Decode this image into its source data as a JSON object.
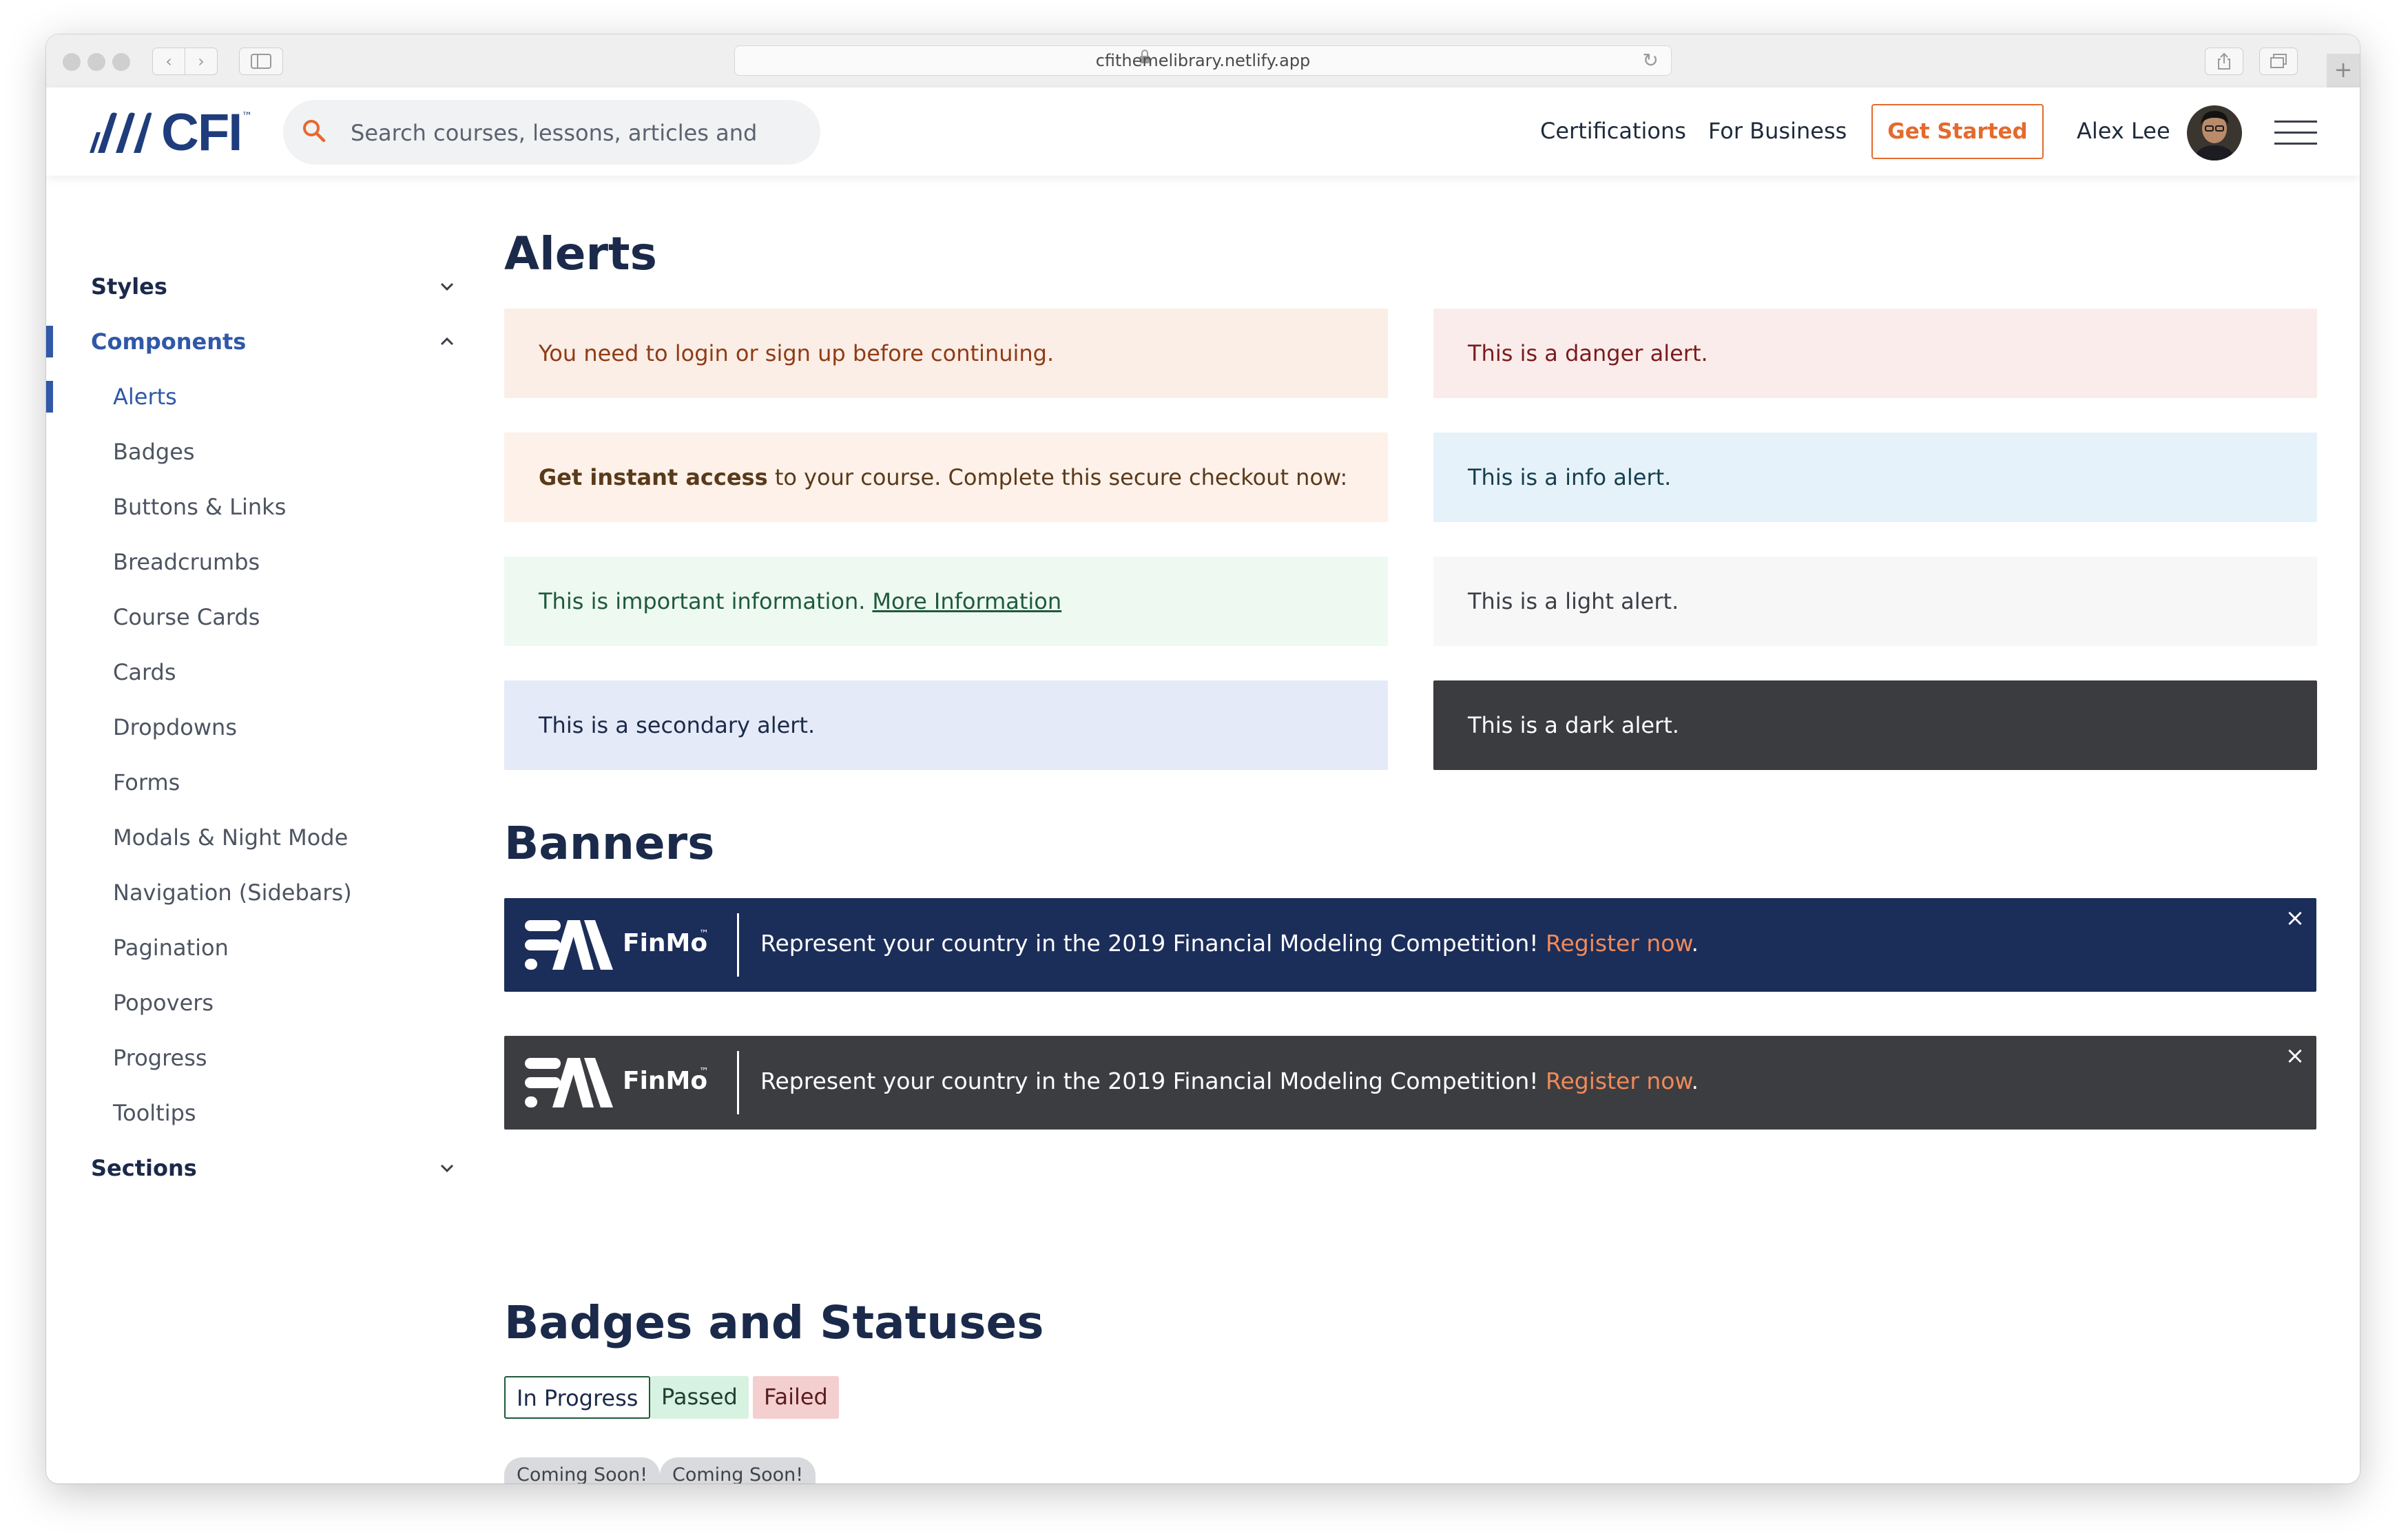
{
  "browser": {
    "url": "cfithemelibrary.netlify.app",
    "new_tab_icon": "+"
  },
  "header": {
    "logo_text": "CFI",
    "logo_tm": "™",
    "search_placeholder": "Search courses, lessons, articles and more",
    "nav": {
      "certifications": "Certifications",
      "for_business": "For Business"
    },
    "get_started": "Get Started",
    "user_name": "Alex Lee"
  },
  "sidebar": {
    "styles": "Styles",
    "components": "Components",
    "sections": "Sections",
    "items": [
      "Alerts",
      "Badges",
      "Buttons & Links",
      "Breadcrumbs",
      "Course Cards",
      "Cards",
      "Dropdowns",
      "Forms",
      "Modals & Night Mode",
      "Navigation (Sidebars)",
      "Pagination",
      "Popovers",
      "Progress",
      "Tooltips"
    ]
  },
  "main": {
    "alerts_title": "Alerts",
    "alerts": {
      "warning": "You need to login or sign up before continuing.",
      "checkout_bold": "Get instant access",
      "checkout_rest": "to your course. Complete this secure checkout now:",
      "success": "This is important information.",
      "success_link": "More Information",
      "secondary": "This is a secondary alert.",
      "danger": "This is a danger alert.",
      "info": "This is a info alert.",
      "light": "This is a light alert.",
      "dark": "This is a dark alert."
    },
    "banners_title": "Banners",
    "banner": {
      "brand": "FinMo",
      "tm": "™",
      "message": "Represent your country in the 2019 Financial Modeling Competition!",
      "cta": "Register now",
      "period": ".",
      "close": "×"
    },
    "badges_title": "Badges and Statuses",
    "badges": {
      "in_progress": "In Progress",
      "passed": "Passed",
      "failed": "Failed",
      "coming_soon": "Coming Soon!"
    }
  },
  "colors": {
    "brand_navy": "#1b2a4a",
    "accent_blue": "#2f58a8",
    "accent_orange": "#e46a2e",
    "banner_navy": "#1b2d59",
    "banner_dark": "#3c3d41"
  }
}
